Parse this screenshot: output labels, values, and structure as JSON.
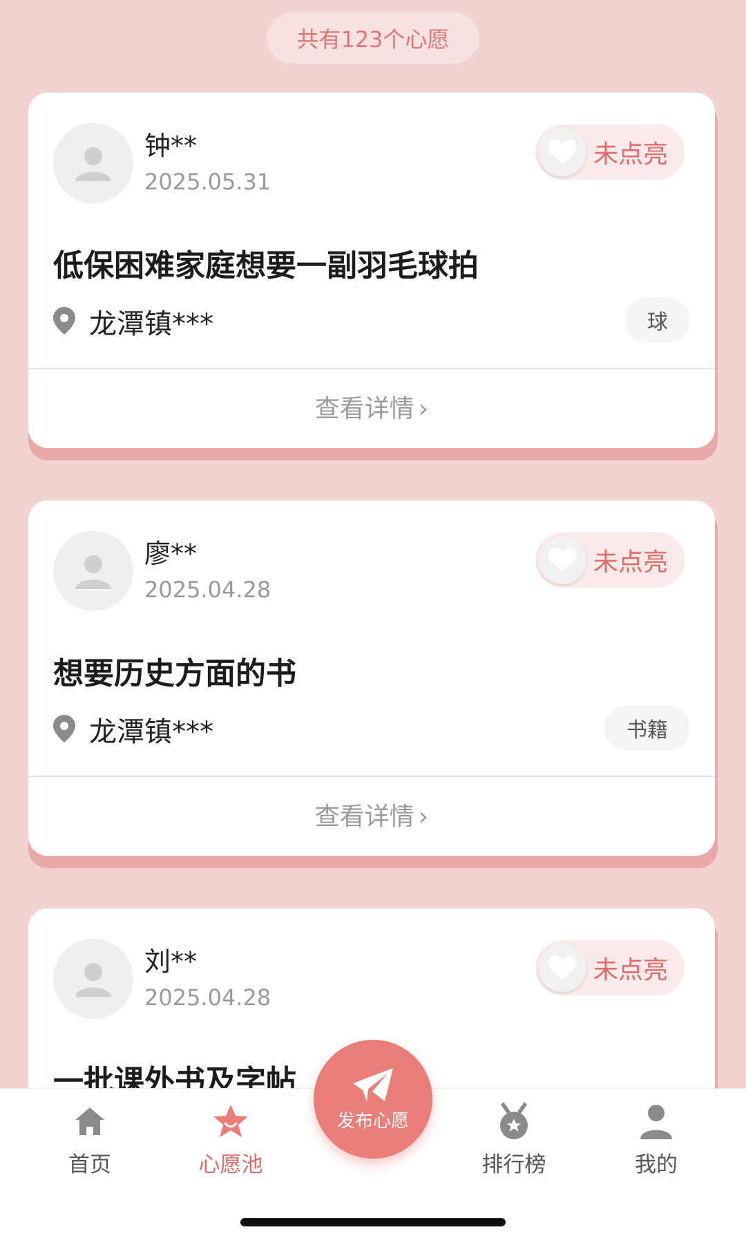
{
  "header": {
    "count_text": "共有123个心愿"
  },
  "wishes": [
    {
      "name": "钟**",
      "date": "2025.05.31",
      "status": "未点亮",
      "title": "低保困难家庭想要一副羽毛球拍",
      "location": "龙潭镇***",
      "tag": "球",
      "detail": "查看详情"
    },
    {
      "name": "廖**",
      "date": "2025.04.28",
      "status": "未点亮",
      "title": "想要历史方面的书",
      "location": "龙潭镇***",
      "tag": "书籍",
      "detail": "查看详情"
    },
    {
      "name": "刘**",
      "date": "2025.04.28",
      "status": "未点亮",
      "title": "一批课外书及字帖"
    }
  ],
  "tabbar": {
    "home": "首页",
    "pool": "心愿池",
    "publish": "发布心愿",
    "ranking": "排行榜",
    "mine": "我的"
  },
  "colors": {
    "background": "#f3d3d2",
    "accent": "#e06b69",
    "card_shadow": "#eaa9a9"
  }
}
